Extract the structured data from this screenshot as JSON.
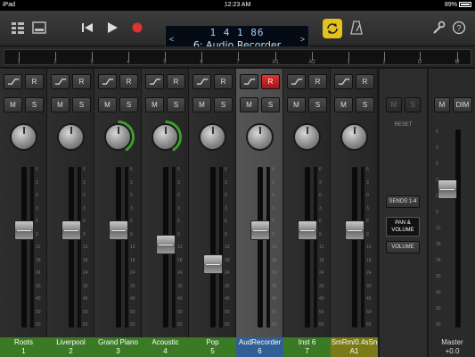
{
  "status": {
    "left": "iPad",
    "time": "12:23 AM",
    "battery": "89%"
  },
  "transport": {
    "position": "1  4  1    86",
    "track_name": "6: Audio Recorder",
    "prev_arrow": "<",
    "next_arrow": ">"
  },
  "ruler": {
    "ticks": [
      "1",
      "2",
      "3",
      "4",
      "5",
      "6",
      "7",
      "A1",
      "A2",
      "1",
      "2",
      "O",
      "M"
    ]
  },
  "strips": [
    {
      "name": "Roots",
      "num": "1",
      "plate": "green",
      "knob_color": "",
      "fader_level": 0.62,
      "selected": false,
      "r_active": false
    },
    {
      "name": "Liverpool",
      "num": "2",
      "plate": "green",
      "knob_color": "",
      "fader_level": 0.62,
      "selected": false,
      "r_active": false
    },
    {
      "name": "Grand Piano",
      "num": "3",
      "plate": "green",
      "knob_color": "#3f9d2e",
      "fader_level": 0.62,
      "selected": false,
      "r_active": false
    },
    {
      "name": "Acoustic",
      "num": "4",
      "plate": "green",
      "knob_color": "#3f9d2e",
      "fader_level": 0.52,
      "selected": false,
      "r_active": false
    },
    {
      "name": "Pop",
      "num": "5",
      "plate": "green",
      "knob_color": "",
      "fader_level": 0.38,
      "selected": false,
      "r_active": false
    },
    {
      "name": "AudRecorder",
      "num": "6",
      "plate": "blue",
      "knob_color": "",
      "fader_level": 0.62,
      "selected": true,
      "r_active": true
    },
    {
      "name": "Inst 6",
      "num": "7",
      "plate": "green",
      "knob_color": "",
      "fader_level": 0.62,
      "selected": false,
      "r_active": false
    },
    {
      "name": "SmRm/0.4sSn",
      "num": "A1",
      "plate": "olive",
      "knob_color": "",
      "fader_level": 0.62,
      "selected": false,
      "r_active": false
    }
  ],
  "labels": {
    "r": "R",
    "m": "M",
    "s": "S",
    "reset": "RESET",
    "dim": "DIM"
  },
  "view": {
    "sends": "SENDS 1-4",
    "pan_volume": "PAN & VOLUME",
    "volume": "VOLUME"
  },
  "master": {
    "name": "Master",
    "value": "+0.0",
    "fader_level": 0.72
  },
  "scale_marks": [
    "6",
    "3",
    "0",
    "3",
    "6",
    "9",
    "12",
    "18",
    "24",
    "30",
    "40",
    "50",
    "60"
  ],
  "colors": {
    "record": "#d33",
    "cycle": "#e5c21b",
    "green_plate": "#3b7a25",
    "blue_plate": "#305e96",
    "olive_plate": "#7a7a18"
  }
}
